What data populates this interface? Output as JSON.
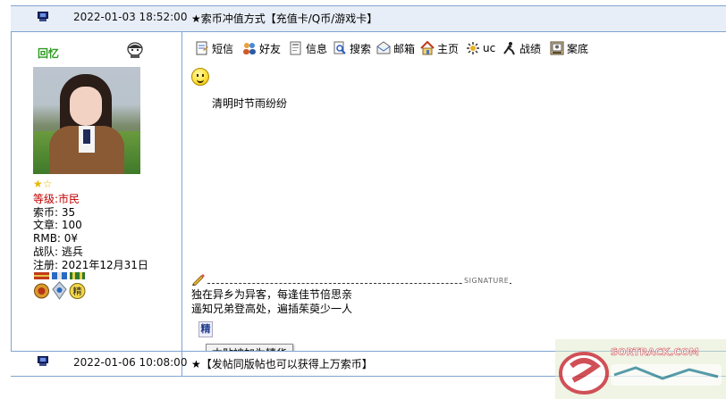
{
  "posts": [
    {
      "date": "2022-01-03 18:52:00",
      "title": "★索币冲值方式【充值卡/Q币/游戏卡】"
    },
    {
      "date": "2022-01-06 10:08:00",
      "title": "★【发帖同版帖也可以获得上万索币】"
    }
  ],
  "user": {
    "name": "回忆",
    "level_label": "等级:",
    "level_value": "市民",
    "stats": [
      "索币: 35",
      "文章: 100",
      "RMB: 0¥",
      "战队: 逃兵",
      "注册: 2021年12月31日"
    ],
    "stars": 1,
    "star_max": 2
  },
  "toolbar": [
    {
      "label": "短信",
      "icon": "note-icon"
    },
    {
      "label": "好友",
      "icon": "friends-icon"
    },
    {
      "label": "信息",
      "icon": "info-icon"
    },
    {
      "label": "搜索",
      "icon": "search-icon"
    },
    {
      "label": "邮箱",
      "icon": "mail-icon"
    },
    {
      "label": "主页",
      "icon": "home-icon"
    },
    {
      "label": "uc",
      "icon": "uc-icon"
    },
    {
      "label": "战绩",
      "icon": "record-icon"
    },
    {
      "label": "案底",
      "icon": "file-icon"
    }
  ],
  "post_body": "清明时节雨纷纷",
  "signature": {
    "label": "SIGNATURE",
    "lines": [
      "独在异乡为异客，每逢佳节倍思亲",
      "遥知兄弟登高处，遍插茱萸少一人"
    ]
  },
  "elite_badge": "精",
  "tooltip": "本贴被加为精华",
  "watermark_text": "SORTRACK.COM",
  "colors": {
    "header_bg": "#e8eef7",
    "border": "#7fa4d0",
    "username": "#2d9b1f",
    "level": "#c00000"
  }
}
